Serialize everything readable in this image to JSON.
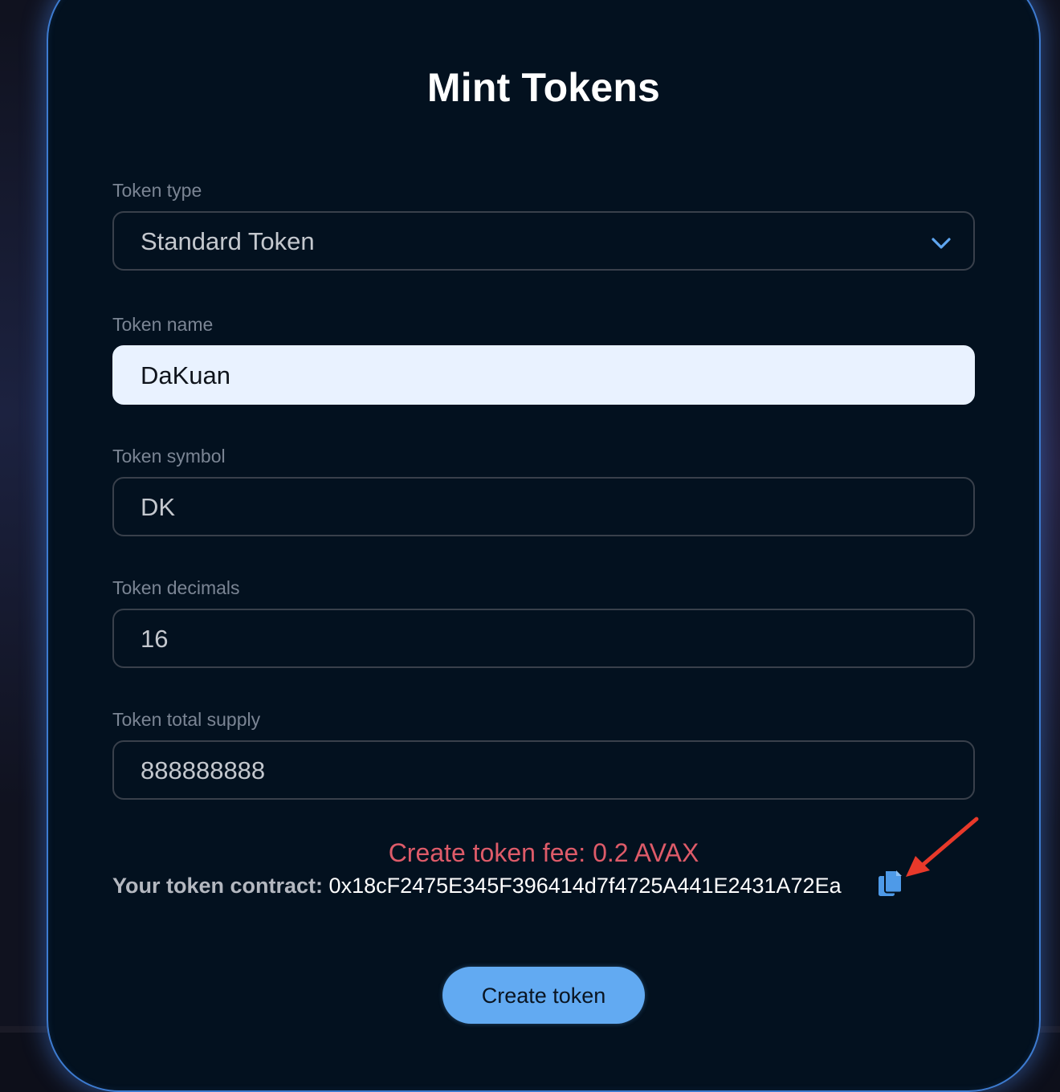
{
  "page": {
    "title": "Mint Tokens"
  },
  "form": {
    "token_type": {
      "label": "Token type",
      "value": "Standard Token"
    },
    "token_name": {
      "label": "Token name",
      "value": "DaKuan"
    },
    "token_symbol": {
      "label": "Token symbol",
      "value": "DK"
    },
    "token_decimals": {
      "label": "Token decimals",
      "value": "16"
    },
    "token_supply": {
      "label": "Token total supply",
      "value": "888888888"
    }
  },
  "fee": {
    "text": "Create token fee: 0.2 AVAX"
  },
  "contract": {
    "label": "Your token contract:",
    "address": "0x18cF2475E345F396414d7f4725A441E2431A72Ea"
  },
  "actions": {
    "create_label": "Create token"
  },
  "colors": {
    "card_background": "#03111f",
    "card_border": "#3d7bd0",
    "fee_text": "#de5b69",
    "button": "#62aaf2",
    "active_field": "#e9f2ff",
    "annotation_arrow": "#e8392a"
  },
  "icons": {
    "select_chevron": "chevron-down-icon",
    "copy": "copy-icon",
    "annotation": "arrow-icon"
  }
}
